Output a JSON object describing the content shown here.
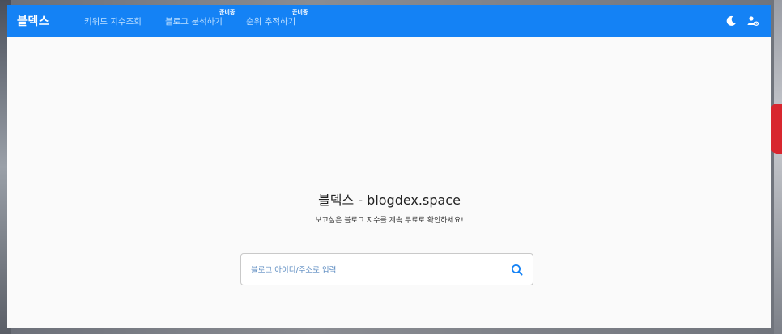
{
  "header": {
    "brand": "블덱스",
    "nav": [
      {
        "label": "키워드 지수조회",
        "badge": ""
      },
      {
        "label": "블로그 분석하기",
        "badge": "준비중"
      },
      {
        "label": "순위 추적하기",
        "badge": "준비중"
      }
    ],
    "icons": {
      "theme": "moon-icon",
      "user": "user-settings-icon"
    }
  },
  "hero": {
    "title": "블덱스 - blogdex.space",
    "subtitle": "보고싶은 블로그 지수를 계속 무료로 확인하세요!"
  },
  "search": {
    "placeholder": "블로그 아이디/주소로 입력",
    "value": "",
    "icon": "search-icon"
  },
  "colors": {
    "primary": "#1482f5",
    "nav_text": "#bfe0ff",
    "page_bg": "#fafafa",
    "search_icon": "#1482f5"
  }
}
